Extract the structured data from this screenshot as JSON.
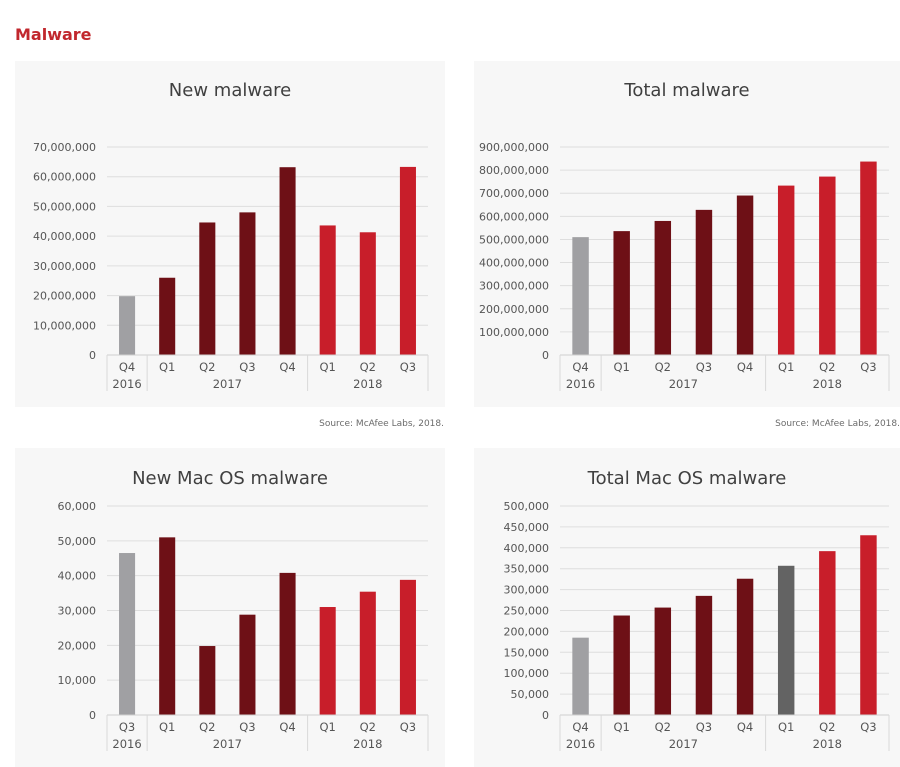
{
  "page": {
    "title": "Malware"
  },
  "colors": {
    "gray": "#a0a0a3",
    "dark_red": "#6e1016",
    "red": "#c81e2a",
    "dark_gray": "#636363"
  },
  "chart_data": [
    {
      "type": "bar",
      "title": "New malware",
      "source": "Source: McAfee Labs, 2018.",
      "categories": [
        "Q4",
        "Q1",
        "Q2",
        "Q3",
        "Q4",
        "Q1",
        "Q2",
        "Q3"
      ],
      "groups": [
        "2016",
        "2017",
        "2018"
      ],
      "values": [
        19800000,
        26000000,
        44600000,
        48000000,
        63200000,
        43600000,
        41300000,
        63300000
      ],
      "bar_colors": [
        "gray",
        "dark_red",
        "dark_red",
        "dark_red",
        "dark_red",
        "red",
        "red",
        "red"
      ],
      "yticks": [
        "0",
        "10,000,000",
        "20,000,000",
        "30,000,000",
        "40,000,000",
        "50,000,000",
        "60,000,000",
        "70,000,000"
      ],
      "ylim": [
        0,
        70000000
      ],
      "grid": true
    },
    {
      "type": "bar",
      "title": "Total malware",
      "source": "Source: McAfee Labs, 2018.",
      "categories": [
        "Q4",
        "Q1",
        "Q2",
        "Q3",
        "Q4",
        "Q1",
        "Q2",
        "Q3"
      ],
      "groups": [
        "2016",
        "2017",
        "2018"
      ],
      "values": [
        510000000,
        536000000,
        580000000,
        628000000,
        690000000,
        733000000,
        772000000,
        837000000
      ],
      "bar_colors": [
        "gray",
        "dark_red",
        "dark_red",
        "dark_red",
        "dark_red",
        "red",
        "red",
        "red"
      ],
      "yticks": [
        "0",
        "100,000,000",
        "200,000,000",
        "300,000,000",
        "400,000,000",
        "500,000,000",
        "600,000,000",
        "700,000,000",
        "800,000,000",
        "900,000,000"
      ],
      "ylim": [
        0,
        900000000
      ],
      "grid": true
    },
    {
      "type": "bar",
      "title": "New Mac OS malware",
      "source": "",
      "categories": [
        "Q3",
        "Q1",
        "Q2",
        "Q3",
        "Q4",
        "Q1",
        "Q2",
        "Q3"
      ],
      "groups": [
        "2016",
        "2017",
        "2018"
      ],
      "values": [
        46500,
        51000,
        19800,
        28800,
        40800,
        31000,
        35400,
        38800
      ],
      "bar_colors": [
        "gray",
        "dark_red",
        "dark_red",
        "dark_red",
        "dark_red",
        "red",
        "red",
        "red"
      ],
      "yticks": [
        "0",
        "10,000",
        "20,000",
        "30,000",
        "40,000",
        "50,000",
        "60,000"
      ],
      "ylim": [
        0,
        60000
      ],
      "grid": true
    },
    {
      "type": "bar",
      "title": "Total Mac OS malware",
      "source": "",
      "categories": [
        "Q4",
        "Q1",
        "Q2",
        "Q3",
        "Q4",
        "Q1",
        "Q2",
        "Q3"
      ],
      "groups": [
        "2016",
        "2017",
        "2018"
      ],
      "values": [
        185000,
        238000,
        257000,
        285000,
        326000,
        357000,
        392000,
        430000
      ],
      "bar_colors": [
        "gray",
        "dark_red",
        "dark_red",
        "dark_red",
        "dark_red",
        "dark_gray",
        "red",
        "red"
      ],
      "yticks": [
        "0",
        "50,000",
        "100,000",
        "150,000",
        "200,000",
        "250,000",
        "300,000",
        "350,000",
        "400,000",
        "450,000",
        "500,000"
      ],
      "ylim": [
        0,
        500000
      ],
      "grid": true
    }
  ]
}
